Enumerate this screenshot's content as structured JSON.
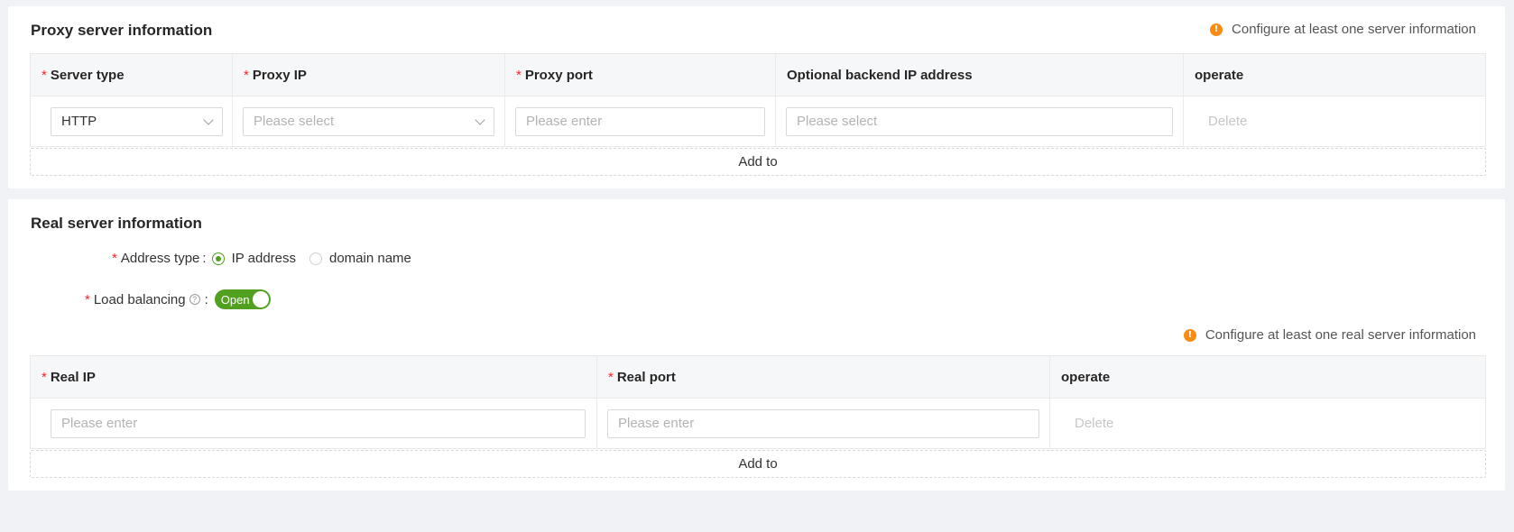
{
  "proxy": {
    "title": "Proxy server information",
    "notice": "Configure at least one server information",
    "columns": {
      "server_type": "Server type",
      "proxy_ip": "Proxy IP",
      "proxy_port": "Proxy port",
      "backend_ip": "Optional backend IP address",
      "operate": "operate"
    },
    "row": {
      "server_type_value": "HTTP",
      "proxy_ip_placeholder": "Please select",
      "proxy_port_placeholder": "Please enter",
      "backend_ip_placeholder": "Please select",
      "delete_label": "Delete"
    },
    "add_label": "Add to"
  },
  "real": {
    "title": "Real server information",
    "address_type_label": "Address type",
    "address_options": [
      "IP address",
      "domain name"
    ],
    "address_selected": "IP address",
    "load_balancing_label": "Load balancing",
    "load_balancing_state": "Open",
    "notice": "Configure at least one real server information",
    "columns": {
      "real_ip": "Real IP",
      "real_port": "Real port",
      "operate": "operate"
    },
    "row": {
      "real_ip_placeholder": "Please enter",
      "real_port_placeholder": "Please enter",
      "delete_label": "Delete"
    },
    "add_label": "Add to"
  },
  "colors": {
    "accent_green": "#52a01f",
    "warning_orange": "#fa8c16",
    "required_red": "#f5222d"
  },
  "icons": {
    "notice": "info-warning-icon",
    "help": "question-circle-icon",
    "dropdown": "chevron-down-icon"
  }
}
